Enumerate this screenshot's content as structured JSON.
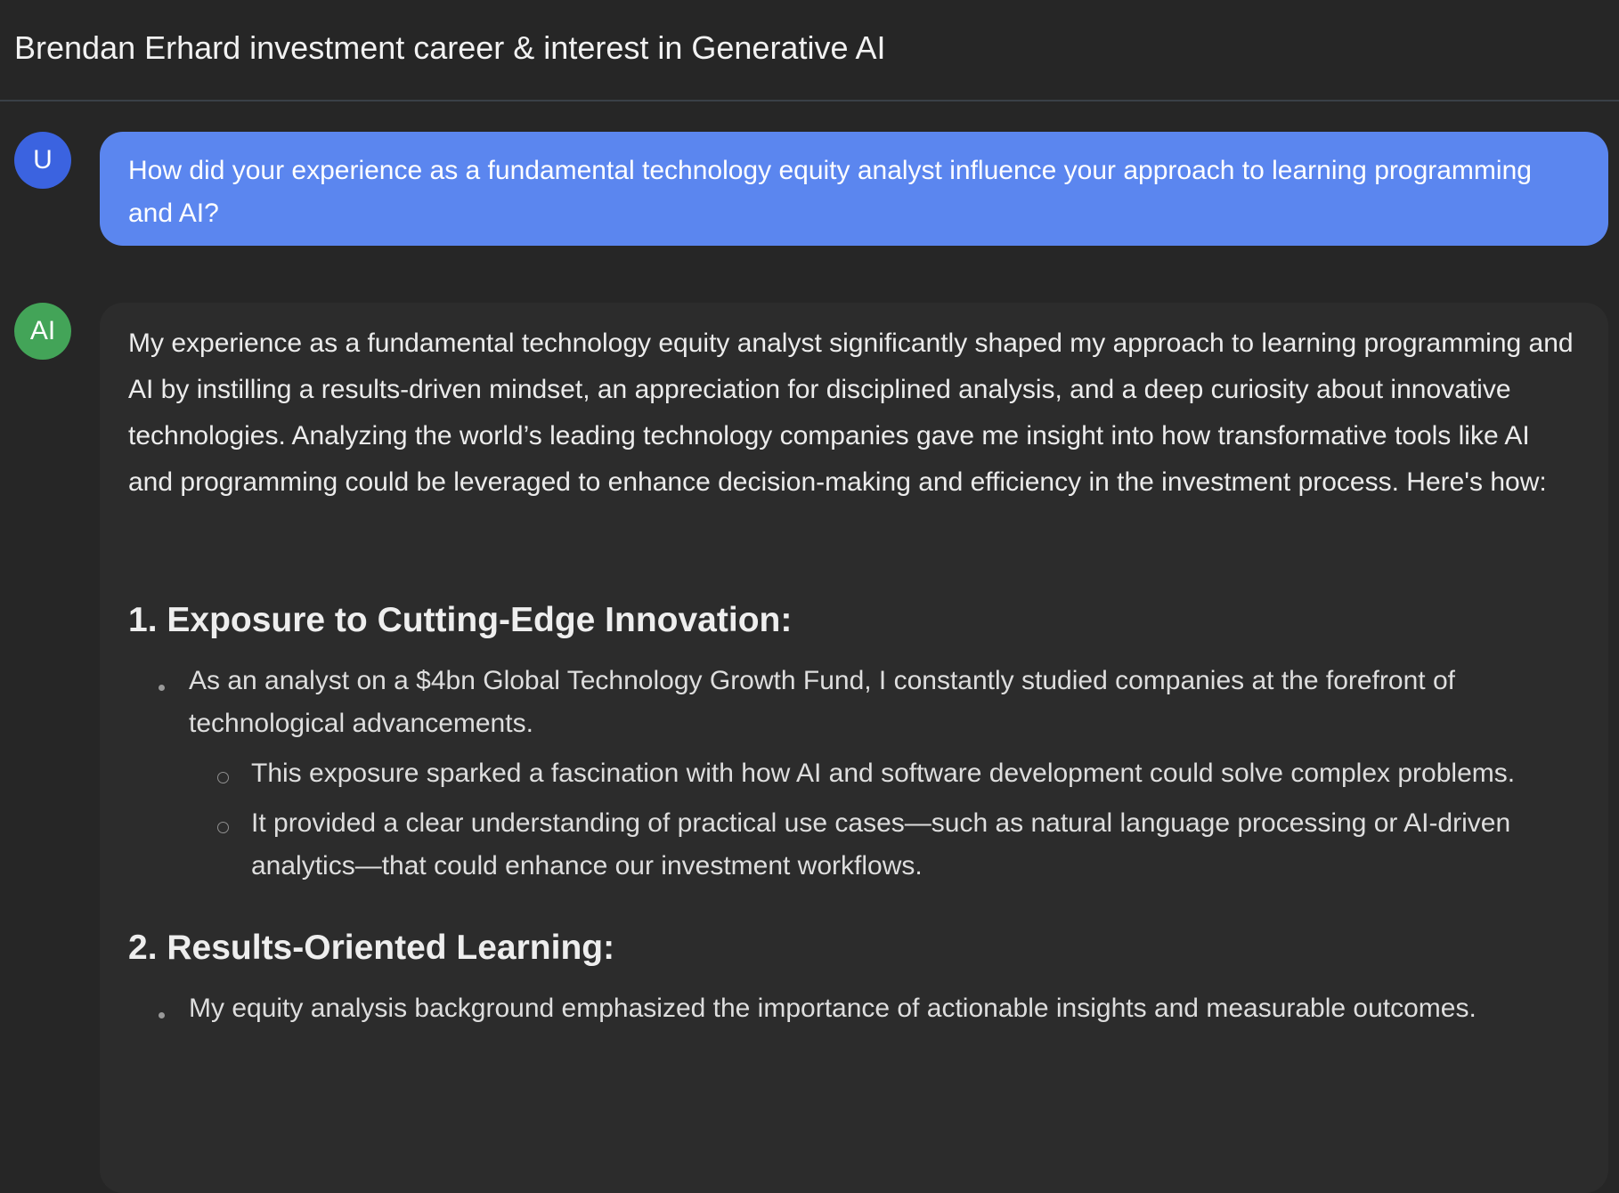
{
  "header": {
    "title": "Brendan Erhard investment career & interest in Generative AI"
  },
  "user_message": {
    "avatar_label": "U",
    "text": "How did your experience as a fundamental technology equity analyst influence your approach to learning programming and AI?"
  },
  "ai_message": {
    "avatar_label": "AI",
    "intro": "My experience as a fundamental technology equity analyst significantly shaped my approach to learning programming and AI by instilling a results-driven mindset, an appreciation for disciplined analysis, and a deep curiosity about innovative technologies. Analyzing the world’s leading technology companies gave me insight into how transformative tools like AI and programming could be leveraged to enhance decision-making and efficiency in the investment process. Here's how:",
    "sections": [
      {
        "heading": "1. Exposure to Cutting-Edge Innovation:",
        "bullet": "As an analyst on a $4bn Global Technology Growth Fund, I constantly studied companies at the forefront of technological advancements.",
        "sub_bullets": [
          "This exposure sparked a fascination with how AI and software development could solve complex problems.",
          "It provided a clear understanding of practical use cases—such as natural language processing or AI-driven analytics—that could enhance our investment workflows."
        ]
      },
      {
        "heading": "2. Results-Oriented Learning:",
        "bullet": "My equity analysis background emphasized the importance of actionable insights and measurable outcomes."
      }
    ]
  }
}
